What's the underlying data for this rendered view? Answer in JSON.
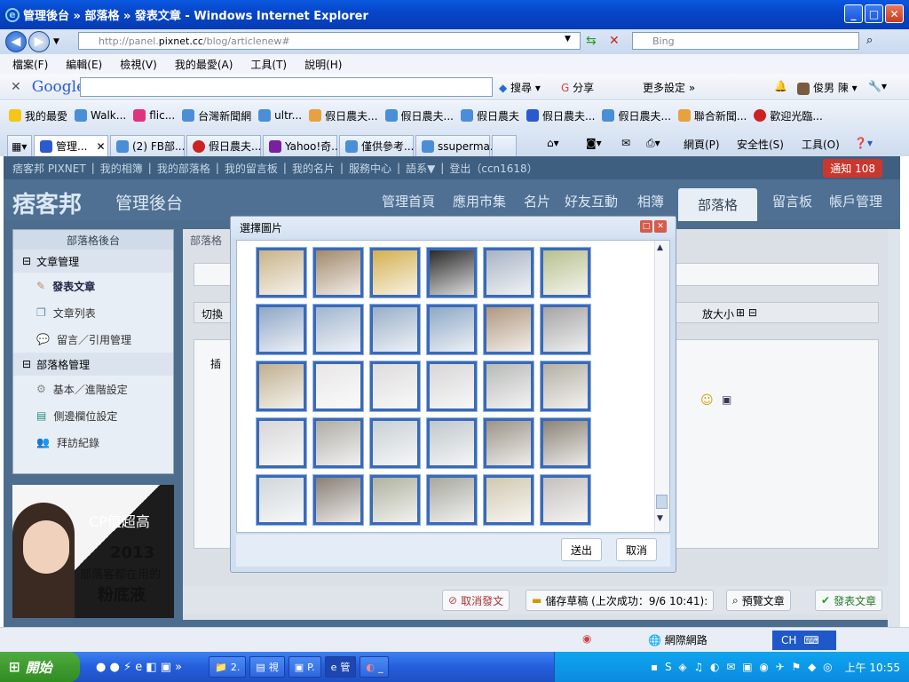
{
  "window": {
    "title": "管理後台 » 部落格 » 發表文章 - Windows Internet Explorer"
  },
  "address": {
    "url_prefix": "http://panel.",
    "url_domain": "pixnet.cc",
    "url_path": "/blog/articlenew#",
    "search_placeholder": "Bing"
  },
  "menu": [
    "檔案(F)",
    "編輯(E)",
    "檢視(V)",
    "我的最愛(A)",
    "工具(T)",
    "說明(H)"
  ],
  "google": {
    "logo": "Google",
    "search_label": "搜尋",
    "share_label": "分享",
    "more_label": "更多設定 »",
    "user": "俊男 陳"
  },
  "favorites": [
    "我的最愛",
    "Walk...",
    "flic...",
    "台灣新聞網",
    "ultr...",
    "假日農夫...",
    "假日農夫...",
    "假日農夫",
    "假日農夫...",
    "假日農夫...",
    "聯合新聞...",
    "歡迎光臨..."
  ],
  "tabs": [
    "管理...",
    "(2) FB部...",
    "假日農夫...",
    "Yahoo!奇...",
    "僅供參考...",
    "ssuperma..."
  ],
  "commands": {
    "page": "網頁(P)",
    "safety": "安全性(S)",
    "tools": "工具(O)"
  },
  "pixnet_top": [
    "痞客邦 PIXNET",
    "我的相簿",
    "我的部落格",
    "我的留言板",
    "我的名片",
    "服務中心",
    "語系▼",
    "登出（ccn1618）"
  ],
  "notification": "通知 108",
  "header": {
    "logo": "痞客邦",
    "subtitle": "管理後台",
    "nav": [
      "管理首頁",
      "應用市集",
      "名片",
      "好友互動",
      "相簿",
      "部落格",
      "留言板",
      "帳戶管理"
    ]
  },
  "sidebar": {
    "head": "部落格後台",
    "sections": [
      {
        "title": "文章管理",
        "items": [
          "發表文章",
          "文章列表",
          "留言／引用管理"
        ]
      },
      {
        "title": "部落格管理",
        "items": [
          "基本／進階設定",
          "側邊欄位設定",
          "拜訪紀錄"
        ]
      }
    ]
  },
  "content": {
    "breadcrumb": "部落格",
    "switch": "切換",
    "insert": "插",
    "size_label": "放大小"
  },
  "ad": {
    "line1": "CP值超高",
    "line2": "2013",
    "line3": "部落客都在用的",
    "line4": "粉底液"
  },
  "bottom": {
    "cancel": "取消發文",
    "draft": "儲存草稿 (上次成功：9/6 10:41):",
    "preview": "預覽文章",
    "publish": "發表文章"
  },
  "dialog": {
    "title": "選擇圖片",
    "submit": "送出",
    "cancel": "取消",
    "rows": [
      [
        "#c8b48a",
        "#a38a6c",
        "#d4b050",
        "#2a2a2a",
        "#a8b4c4",
        "#b8c090"
      ],
      [
        "#8fa7c7",
        "#a2b6cf",
        "#9aafc8",
        "#8ea8c6",
        "#b09880",
        "#a6a4a4"
      ],
      [
        "#c0b090",
        "#e8e6e6",
        "#dedcdc",
        "#d8d6d6",
        "#b8bab8",
        "#b4b0a4"
      ],
      [
        "#d8d6d6",
        "#b0ada6",
        "#c8d0d4",
        "#c0c8cc",
        "#9c9488",
        "#8c8478"
      ],
      [
        "#d0d6da",
        "#8a8078",
        "#b0b2a0",
        "#a8a8a0",
        "#d0c8b0",
        "#c4c0bc"
      ]
    ]
  },
  "status": {
    "network": "網際網路",
    "ime": "CH"
  },
  "taskbar": {
    "start": "開始",
    "buttons": [
      "2.",
      "視",
      "P.",
      "管",
      "_"
    ],
    "clock": "上午 10:55"
  }
}
